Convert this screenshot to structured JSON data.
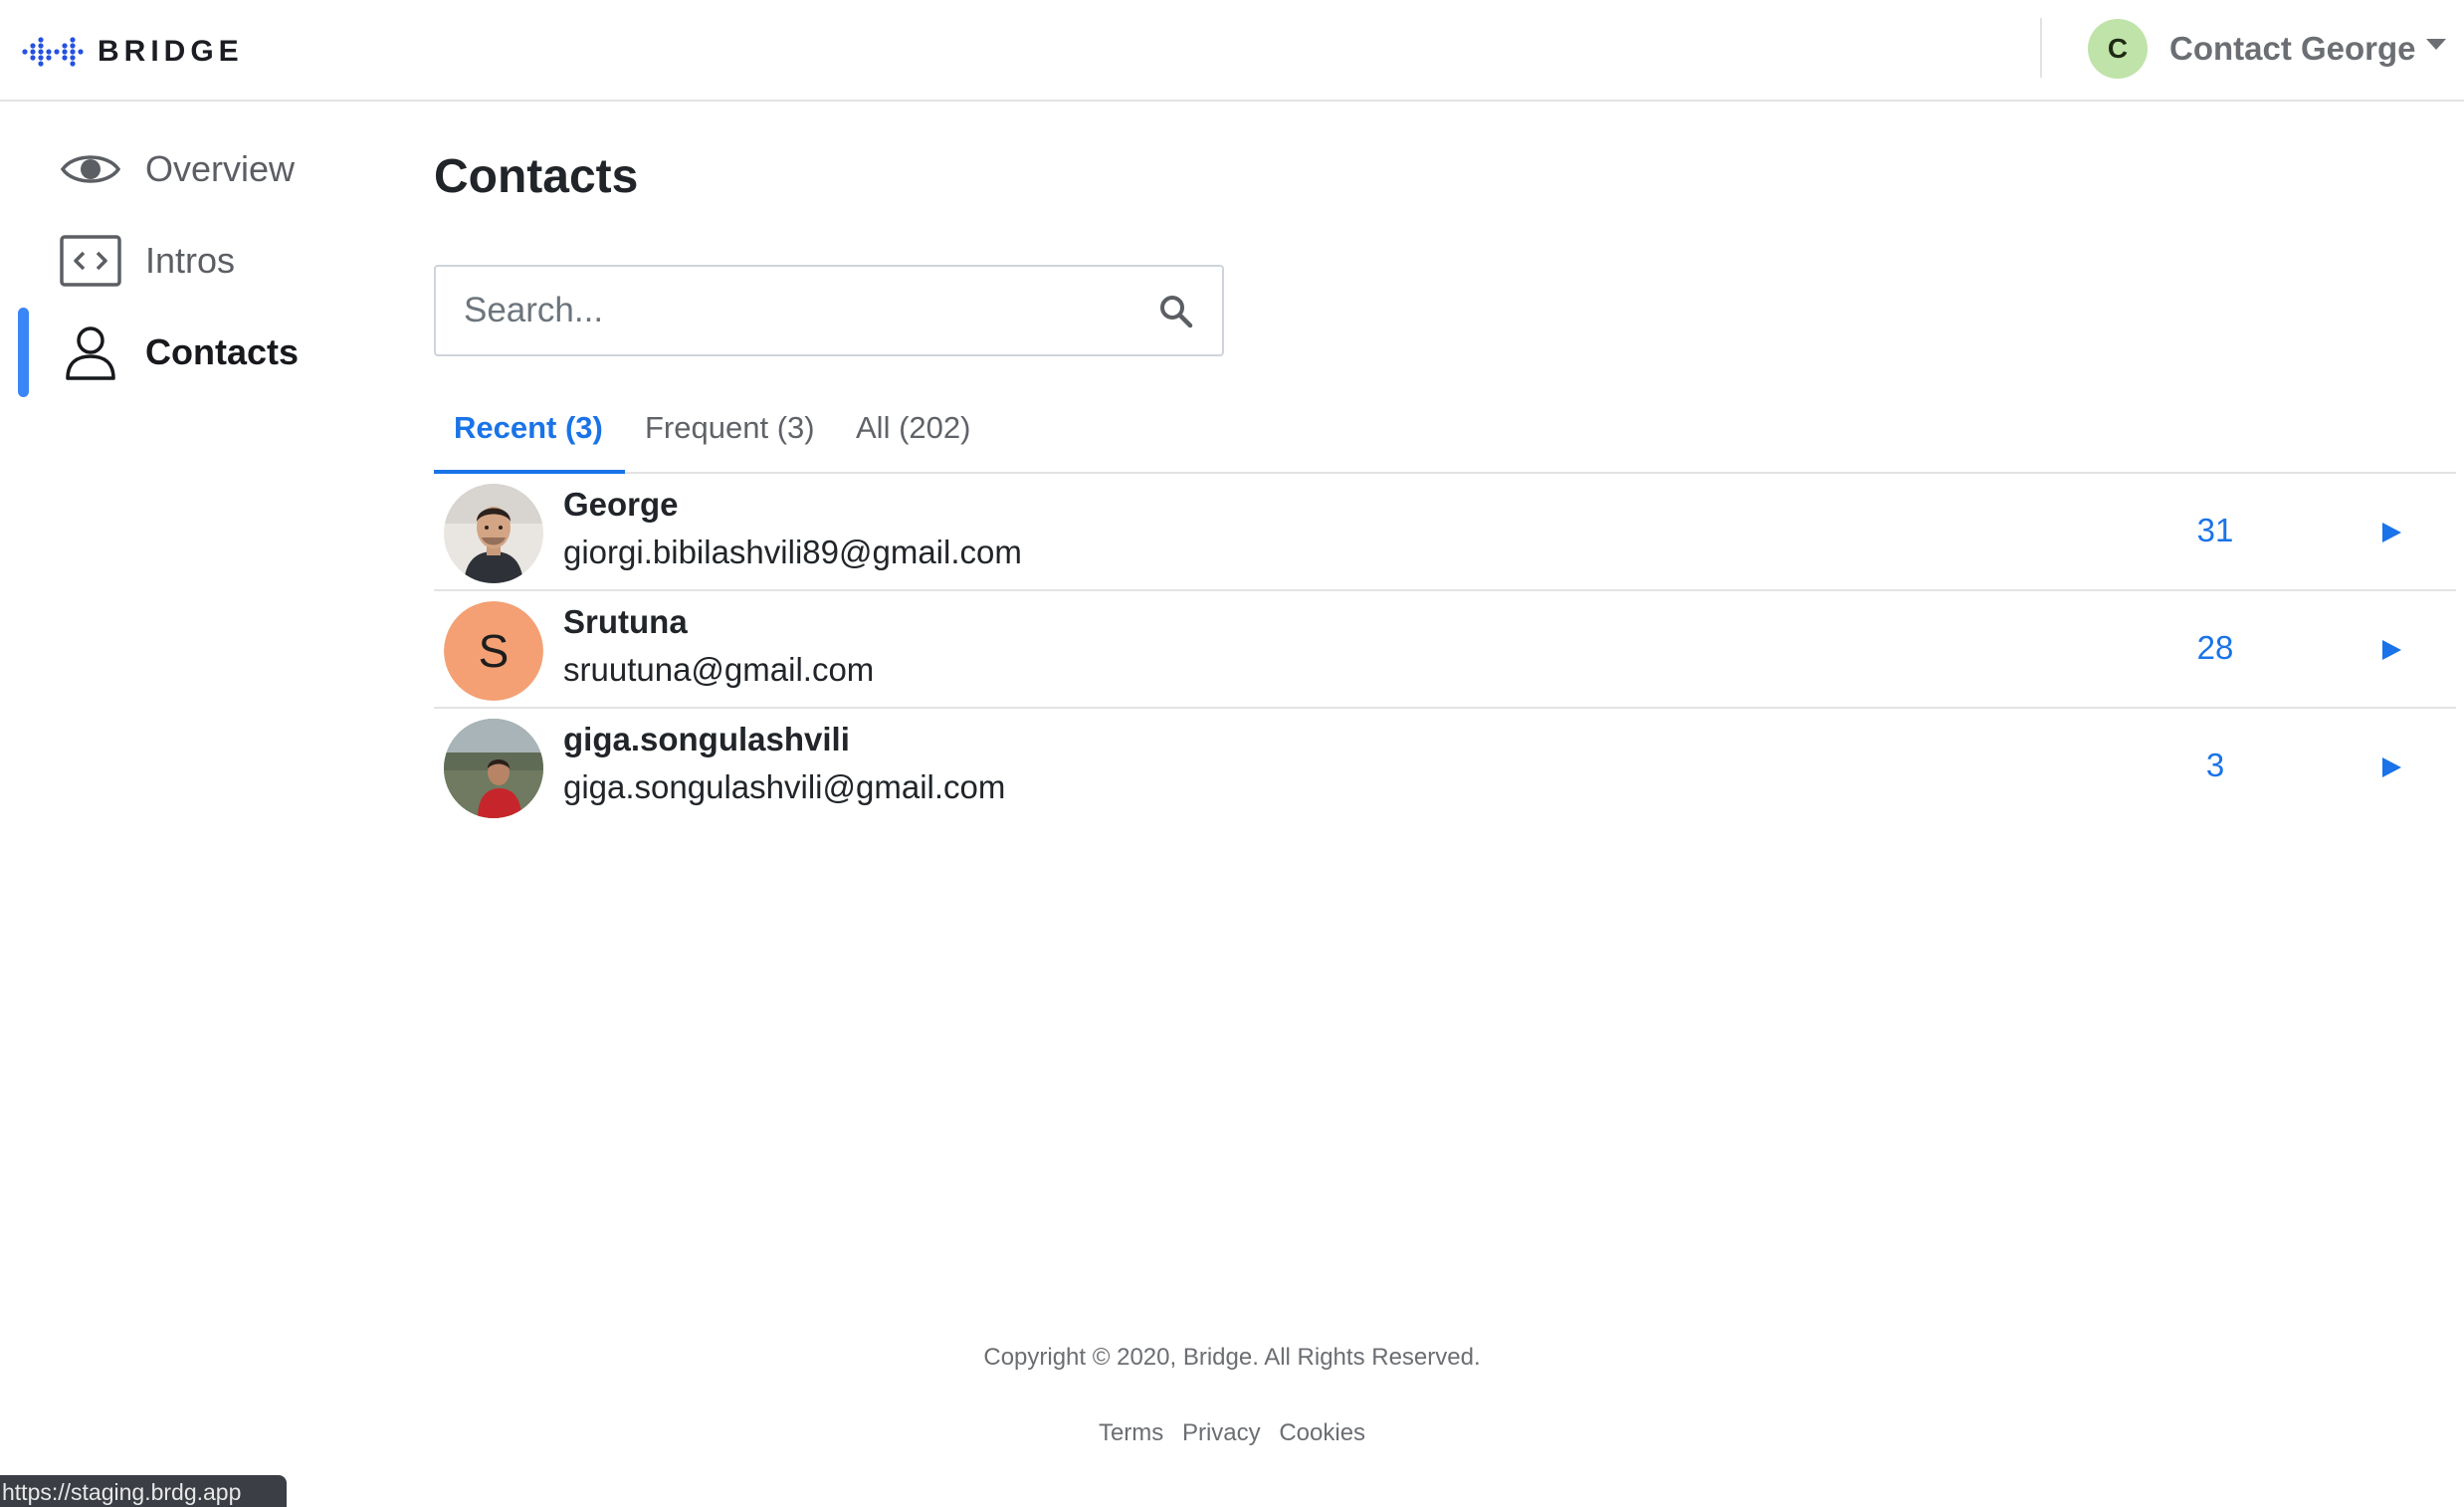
{
  "header": {
    "logo_text": "BRIDGE",
    "account": {
      "initial": "C",
      "name": "Contact George"
    }
  },
  "sidebar": {
    "items": [
      {
        "label": "Overview",
        "icon": "eye-icon",
        "active": false
      },
      {
        "label": "Intros",
        "icon": "code-brackets-icon",
        "active": false
      },
      {
        "label": "Contacts",
        "icon": "person-icon",
        "active": true
      }
    ]
  },
  "main": {
    "title": "Contacts",
    "search": {
      "placeholder": "Search...",
      "value": ""
    },
    "tabs": [
      {
        "label": "Recent (3)",
        "active": true
      },
      {
        "label": "Frequent (3)",
        "active": false
      },
      {
        "label": "All (202)",
        "active": false
      }
    ],
    "contacts": [
      {
        "name": "George",
        "email": "giorgi.bibilashvili89@gmail.com",
        "count": "31",
        "avatar": "photo"
      },
      {
        "name": "Srutuna",
        "email": "sruutuna@gmail.com",
        "count": "28",
        "avatar": "letter",
        "initial": "S"
      },
      {
        "name": "giga.songulashvili",
        "email": "giga.songulashvili@gmail.com",
        "count": "3",
        "avatar": "photo"
      }
    ]
  },
  "footer": {
    "copyright": "Copyright © 2020, Bridge. All Rights Reserved.",
    "links": [
      "Terms",
      "Privacy",
      "Cookies"
    ]
  },
  "status_bar": {
    "url": "https://staging.brdg.app"
  },
  "colors": {
    "accent": "#1a73e8",
    "sidebar_indicator": "#3b86f7",
    "account_avatar_bg": "#bfe3a9",
    "letter_avatar_bg": "#f4a074",
    "logo_dots": "#2451e0"
  }
}
